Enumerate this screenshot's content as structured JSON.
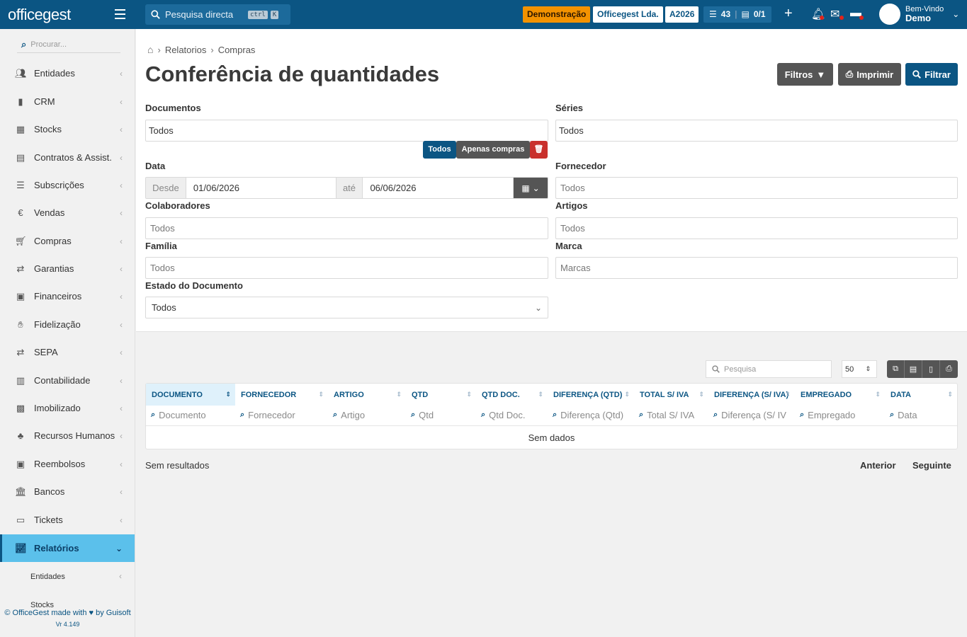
{
  "topbar": {
    "logo": "officegest",
    "search_placeholder": "Pesquisa directa",
    "kbd_ctrl": "ctrl",
    "kbd_k": "K",
    "badge_demo": "Demonstração",
    "badge_company": "Officegest Lda.",
    "badge_year": "A2026",
    "tasks_count": "43",
    "docs_count": "0/1",
    "user_greeting": "Bem-Vindo",
    "user_name": "Demo",
    "colors": {
      "bar": "#0b5583",
      "demo": "#f39200"
    }
  },
  "sidebar": {
    "search_placeholder": "Procurar...",
    "items": [
      {
        "label": "Entidades",
        "icon": "users-icon"
      },
      {
        "label": "CRM",
        "icon": "book-icon"
      },
      {
        "label": "Stocks",
        "icon": "warehouse-icon"
      },
      {
        "label": "Contratos & Assist.",
        "icon": "file-contract-icon"
      },
      {
        "label": "Subscrições",
        "icon": "list-icon"
      },
      {
        "label": "Vendas",
        "icon": "euro-icon"
      },
      {
        "label": "Compras",
        "icon": "cart-icon"
      },
      {
        "label": "Garantias",
        "icon": "exchange-icon"
      },
      {
        "label": "Financeiros",
        "icon": "money-icon"
      },
      {
        "label": "Fidelização",
        "icon": "hand-holding-icon"
      },
      {
        "label": "SEPA",
        "icon": "exchange-icon"
      },
      {
        "label": "Contabilidade",
        "icon": "calculator-icon"
      },
      {
        "label": "Imobilizado",
        "icon": "box-icon"
      },
      {
        "label": "Recursos Humanos",
        "icon": "sitemap-icon"
      },
      {
        "label": "Reembolsos",
        "icon": "money-icon"
      },
      {
        "label": "Bancos",
        "icon": "bank-icon"
      },
      {
        "label": "Tickets",
        "icon": "ticket-icon"
      },
      {
        "label": "Relatórios",
        "icon": "chart-icon"
      }
    ],
    "sub_items": [
      "Entidades",
      "Stocks"
    ],
    "footer": "© OfficeGest made with ♥ by Guisoft",
    "version": "Vr 4.149"
  },
  "breadcrumb": {
    "items": [
      "Relatorios",
      "Compras"
    ]
  },
  "page": {
    "title": "Conferência de quantidades",
    "btn_filtros": "Filtros",
    "btn_imprimir": "Imprimir",
    "btn_filtrar": "Filtrar"
  },
  "form": {
    "documentos_label": "Documentos",
    "documentos_value": "Todos",
    "chip_todos": "Todos",
    "chip_apenas": "Apenas compras",
    "series_label": "Séries",
    "series_value": "Todos",
    "data_label": "Data",
    "desde": "Desde",
    "date_from": "01/06/2026",
    "ate": "até",
    "date_to": "06/06/2026",
    "fornecedor_label": "Fornecedor",
    "fornecedor_ph": "Todos",
    "colaboradores_label": "Colaboradores",
    "colaboradores_ph": "Todos",
    "artigos_label": "Artigos",
    "artigos_ph": "Todos",
    "familia_label": "Família",
    "familia_ph": "Todos",
    "marca_label": "Marca",
    "marca_ph": "Marcas",
    "estado_label": "Estado do Documento",
    "estado_value": "Todos"
  },
  "table": {
    "search_placeholder": "Pesquisa",
    "page_size": "50",
    "columns": [
      "Documento",
      "Fornecedor",
      "Artigo",
      "QTD",
      "QTD Doc.",
      "Diferença (QTD)",
      "Total S/ IVA",
      "Diferença (S/ IVA)",
      "Empregado",
      "Data"
    ],
    "filters": [
      "Documento",
      "Fornecedor",
      "Artigo",
      "Qtd",
      "Qtd Doc.",
      "Diferença (Qtd)",
      "Total S/ IVA",
      "Diferença (S/ IV",
      "Empregado",
      "Data"
    ],
    "empty": "Sem dados",
    "result_text": "Sem resultados",
    "prev": "Anterior",
    "next": "Seguinte"
  }
}
